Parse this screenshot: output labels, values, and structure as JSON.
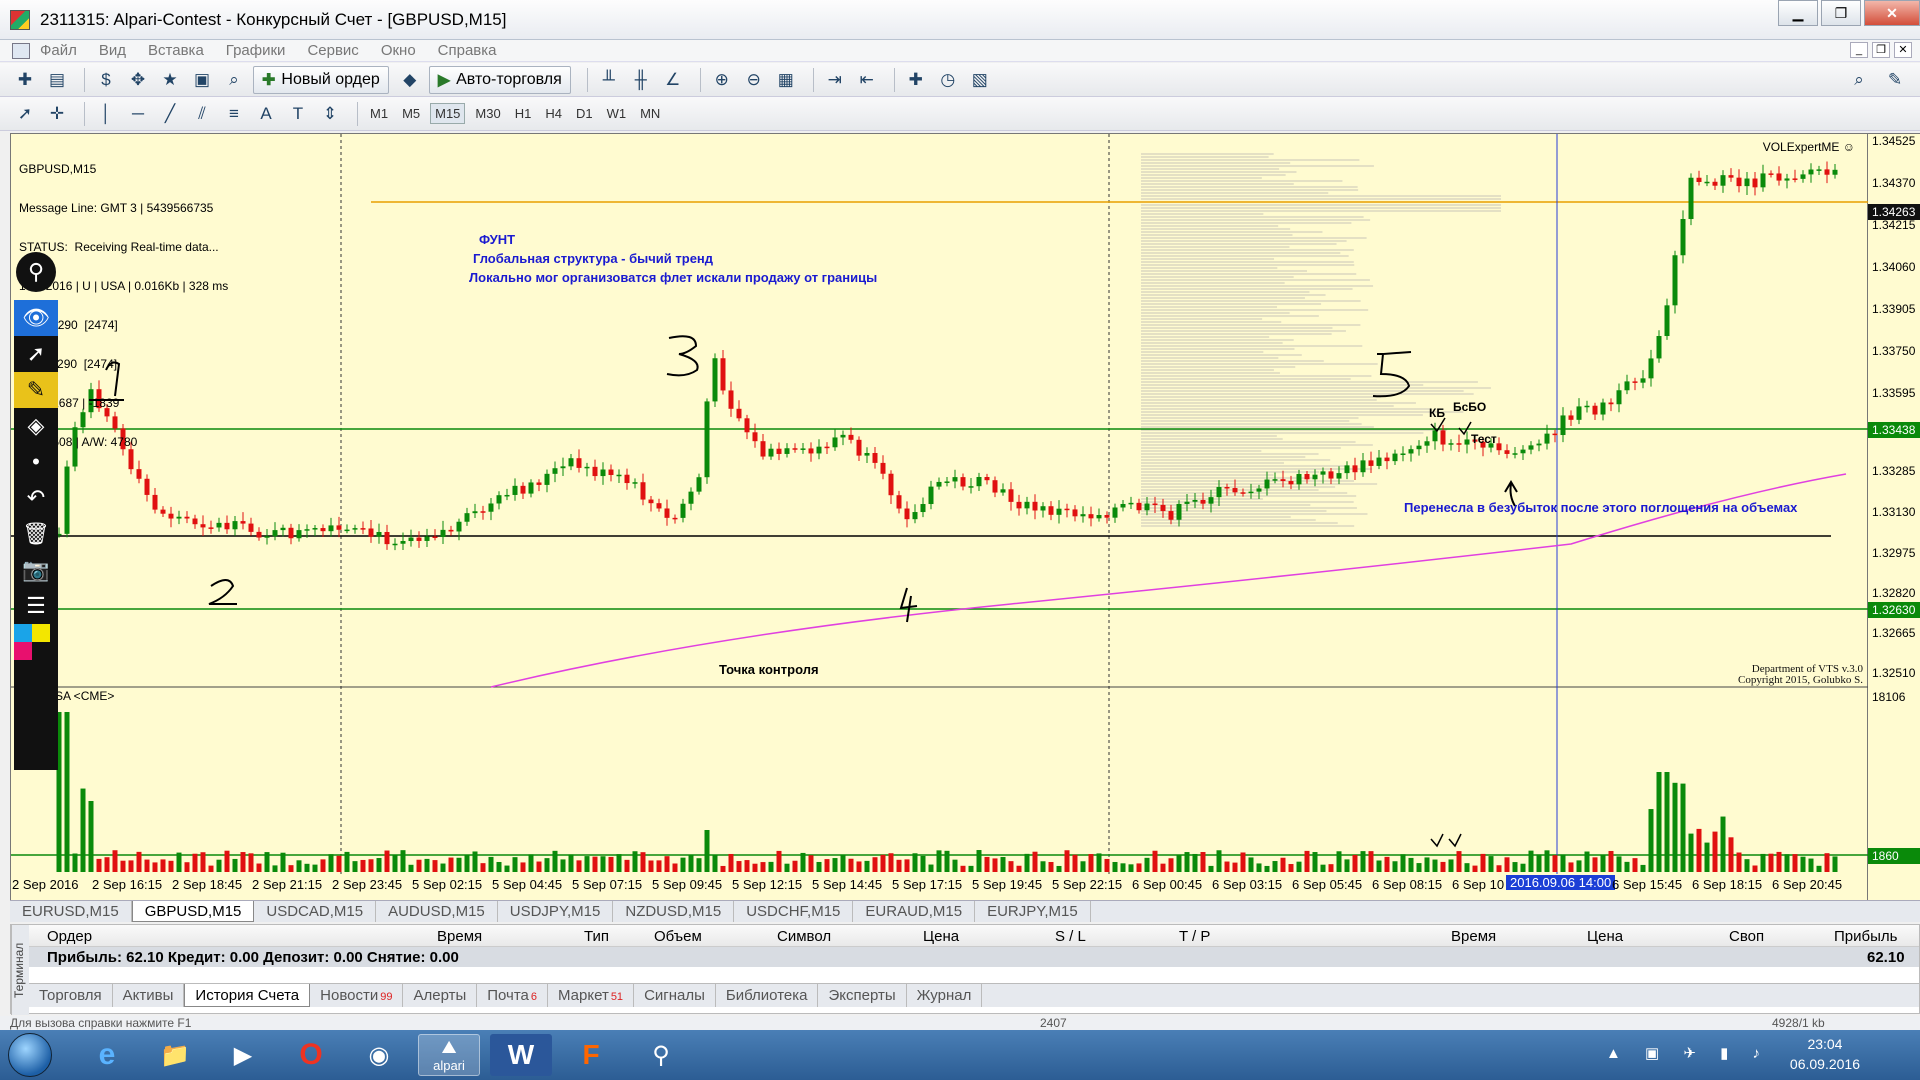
{
  "window": {
    "title": "2311315: Alpari-Contest - Конкурсный Счет - [GBPUSD,M15]",
    "controls": [
      "▁",
      "❐",
      "✕"
    ]
  },
  "menu": {
    "items": [
      "Файл",
      "Вид",
      "Вставка",
      "Графики",
      "Сервис",
      "Окно",
      "Справка"
    ]
  },
  "toolbar": {
    "new_order_label": "Новый ордер",
    "auto_trading_label": "Авто-торговля",
    "timeframes": [
      "M1",
      "M5",
      "M15",
      "M30",
      "H1",
      "H4",
      "D1",
      "W1",
      "MN"
    ],
    "active_timeframe": "M15"
  },
  "chart": {
    "header_lines": [
      "GBPUSD,M15",
      "Message Line: GMT 3 | 5439566735",
      "STATUS:  Receiving Real-time data...",
      "13/9/2016 | U | USA | 0.016Kb | 328 ms",
      "D: 1.34290  [2474]",
      "S: 1.34290  [2474]",
      "V|D: 82687 | -1839",
      "A/D: 2508 | A/W: 4780"
    ],
    "indicator_name": "VOLExpertME ☺",
    "volume_label": "SA <CME>",
    "credit_line1": "Department of VTS  v.3.0",
    "credit_line2": "Copyright 2015, Golubko S.",
    "annotations": {
      "title": "ФУНТ",
      "line1": "Глобальная структура - бычий тренд",
      "line2": "Локально мог организоватся флет искали продажу от границы",
      "control_point": "Точка контроля",
      "kb": "КБ",
      "bsbo": "БсБО",
      "test": "Тест",
      "breakeven": "Перенесла в безубыток после этого поглощения на объемах"
    },
    "handwritten_numbers": [
      "1",
      "2",
      "3",
      "4",
      "5"
    ],
    "colors": {
      "background": "#fffbd0",
      "bull": "#0a8a0a",
      "bear": "#e01010",
      "level_line": "#0a8a0a",
      "support_line": "#000000",
      "orange_line": "#e8a000",
      "ma_line": "#e040e0",
      "cursor_line": "#2a3ed6"
    }
  },
  "price_axis": {
    "labels": [
      "1.34525",
      "1.34370",
      "1.34215",
      "1.34060",
      "1.33905",
      "1.33750",
      "1.33595",
      "1.33285",
      "1.33130",
      "1.32975",
      "1.32820",
      "1.32665",
      "1.32510"
    ],
    "current_price": "1.34263",
    "level_upper": "1.33438",
    "level_lower": "1.32630",
    "volume_max": "18106",
    "volume_level": "1860"
  },
  "time_axis": {
    "labels": [
      "2 Sep 2016",
      "2 Sep 16:15",
      "2 Sep 18:45",
      "2 Sep 21:15",
      "2 Sep 23:45",
      "5 Sep 02:15",
      "5 Sep 04:45",
      "5 Sep 07:15",
      "5 Sep 09:45",
      "5 Sep 12:15",
      "5 Sep 14:45",
      "5 Sep 17:15",
      "5 Sep 19:45",
      "5 Sep 22:15",
      "6 Sep 00:45",
      "6 Sep 03:15",
      "6 Sep 05:45",
      "6 Sep 08:15",
      "6 Sep 10",
      "6 Sep 15:45",
      "6 Sep 18:15",
      "6 Sep 20:45"
    ],
    "cursor_label": "2016.09.06 14:00"
  },
  "symbol_tabs": [
    "EURUSD,M15",
    "GBPUSD,M15",
    "USDCAD,M15",
    "AUDUSD,M15",
    "USDJPY,M15",
    "NZDUSD,M15",
    "USDCHF,M15",
    "EURAUD,M15",
    "EURJPY,M15"
  ],
  "active_symbol_tab": "GBPUSD,M15",
  "terminal": {
    "side_label": "Терминал",
    "columns": [
      "Ордер",
      "Время",
      "Тип",
      "Объем",
      "Символ",
      "Цена",
      "S / L",
      "T / P",
      "Время",
      "Цена",
      "Своп",
      "Прибыль"
    ],
    "summary": "Прибыль: 62.10  Кредит: 0.00  Депозит: 0.00  Снятие: 0.00",
    "summary_total": "62.10",
    "tabs": [
      {
        "label": "Торговля",
        "badge": ""
      },
      {
        "label": "Активы",
        "badge": ""
      },
      {
        "label": "История Счета",
        "badge": ""
      },
      {
        "label": "Новости",
        "badge": "99"
      },
      {
        "label": "Алерты",
        "badge": ""
      },
      {
        "label": "Почта",
        "badge": "6"
      },
      {
        "label": "Маркет",
        "badge": "51"
      },
      {
        "label": "Сигналы",
        "badge": ""
      },
      {
        "label": "Библиотека",
        "badge": ""
      },
      {
        "label": "Эксперты",
        "badge": ""
      },
      {
        "label": "Журнал",
        "badge": ""
      }
    ],
    "active_tab": "История Счета"
  },
  "statusbar": {
    "help": "Для вызова справки нажмите F1",
    "value": "2407",
    "traffic": "4928/1 kb"
  },
  "taskbar": {
    "apps": [
      "ie-icon",
      "explorer-icon",
      "media-player-icon",
      "opera-icon",
      "chrome-icon",
      "alpari-icon",
      "word-icon",
      "fl-icon",
      "vts-icon"
    ],
    "alpari_label": "alpari",
    "time": "23:04",
    "date": "06.09.2016"
  }
}
